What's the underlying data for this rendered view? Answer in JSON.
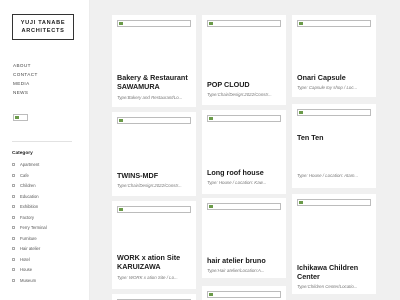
{
  "site": {
    "logo_line1": "YUJI TANABE",
    "logo_line2": "ARCHITECTS"
  },
  "nav": [
    "ABOUT",
    "CONTACT",
    "MEDIA",
    "NEWS"
  ],
  "sidebar_image": "broken-image-icon",
  "category": {
    "title": "Category",
    "items": [
      "Apartment",
      "Cafe",
      "Children",
      "Education",
      "Exhibition",
      "Factory",
      "Ferry Terminal",
      "Furniture",
      "Hair atelier",
      "Hotel",
      "House",
      "Museum"
    ]
  },
  "projects": [
    {
      "title_lines": [
        "Bakery & Restaurant",
        "SAWAMURA"
      ],
      "meta": "Type:Bakery and Restaurant/Lo..."
    },
    {
      "title_lines": [
        "TWINS-MDF"
      ],
      "meta": "Type:Chair/Design:2022/Constr..."
    },
    {
      "title_lines": [
        "WORK x ation Site",
        "KARUIZAWA"
      ],
      "meta": "Type: WORK x ation Site / Lo..."
    },
    {
      "title_lines": [
        "POP CLOUD"
      ],
      "meta": "Type:Chair/Design:2022/Constr..."
    },
    {
      "title_lines": [
        "Long roof house"
      ],
      "meta": "Type: House / Location: Kaw..."
    },
    {
      "title_lines": [
        "hair atelier bruno"
      ],
      "meta": "Type:Hair atelier/Location:A..."
    },
    {
      "title_lines": [
        "Onari Capsule"
      ],
      "meta": "Type: Capsule toy shop / Loc..."
    },
    {
      "title_lines": [
        "Ten Ten"
      ],
      "meta": "Type: House / Location: Atam..."
    },
    {
      "title_lines": [
        "Ichikawa Children",
        "Center"
      ],
      "meta": "Type:Children Center/Locatio..."
    }
  ]
}
